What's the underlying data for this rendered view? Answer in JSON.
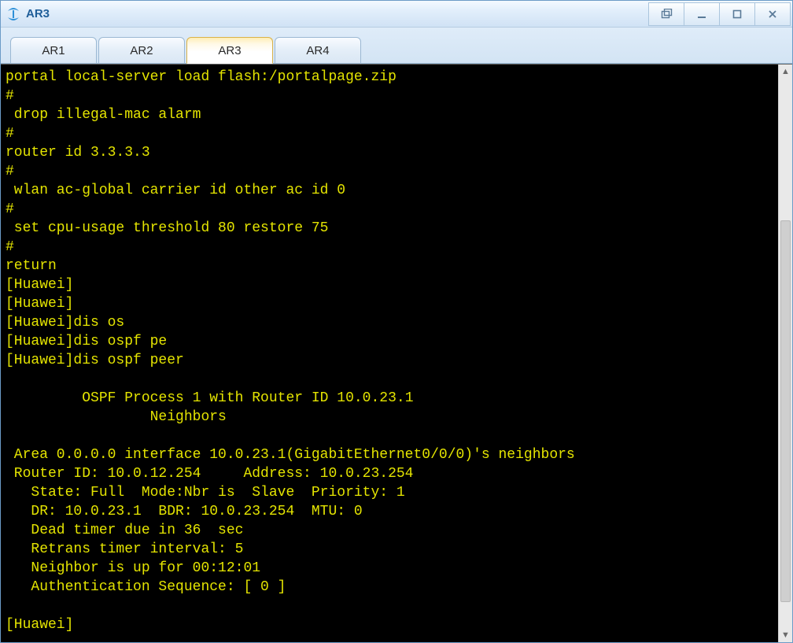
{
  "window": {
    "title": "AR3"
  },
  "tabs": [
    {
      "label": "AR1",
      "active": false
    },
    {
      "label": "AR2",
      "active": false
    },
    {
      "label": "AR3",
      "active": true
    },
    {
      "label": "AR4",
      "active": false
    }
  ],
  "terminal_lines": [
    "portal local-server load flash:/portalpage.zip",
    "#",
    " drop illegal-mac alarm",
    "#",
    "router id 3.3.3.3",
    "#",
    " wlan ac-global carrier id other ac id 0",
    "#",
    " set cpu-usage threshold 80 restore 75",
    "#",
    "return",
    "[Huawei]",
    "[Huawei]",
    "[Huawei]dis os",
    "[Huawei]dis ospf pe",
    "[Huawei]dis ospf peer",
    "",
    "\t OSPF Process 1 with Router ID 10.0.23.1",
    "\t\t Neighbors ",
    "",
    " Area 0.0.0.0 interface 10.0.23.1(GigabitEthernet0/0/0)'s neighbors",
    " Router ID: 10.0.12.254     Address: 10.0.23.254       ",
    "   State: Full  Mode:Nbr is  Slave  Priority: 1",
    "   DR: 10.0.23.1  BDR: 10.0.23.254  MTU: 0    ",
    "   Dead timer due in 36  sec ",
    "   Retrans timer interval: 5 ",
    "   Neighbor is up for 00:12:01     ",
    "   Authentication Sequence: [ 0 ] ",
    "",
    "[Huawei]"
  ],
  "icons": {
    "app": "app-logo-icon",
    "popout": "popout-icon",
    "minimize": "minimize-icon",
    "maximize": "maximize-icon",
    "close": "close-icon"
  }
}
